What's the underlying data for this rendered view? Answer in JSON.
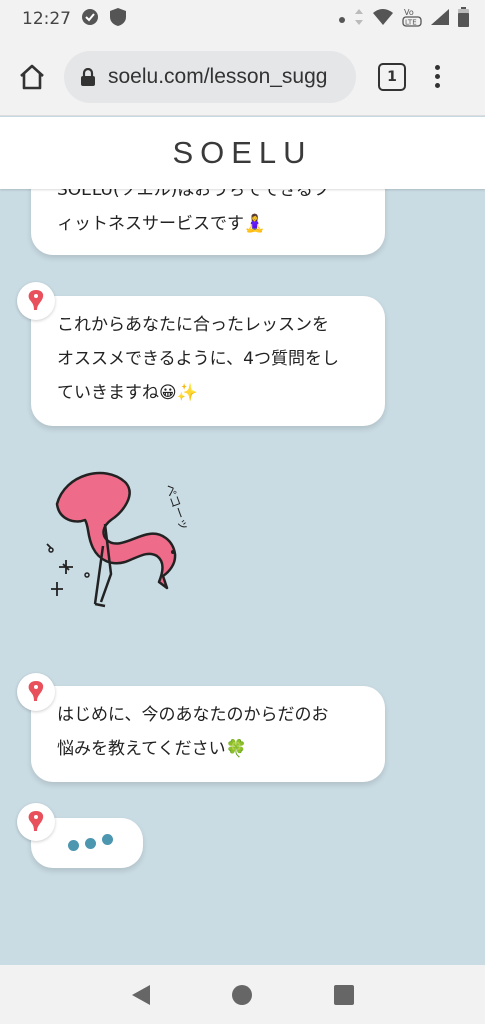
{
  "status": {
    "time": "12:27",
    "left_icons": [
      "sync-icon",
      "shield-icon"
    ],
    "right_icons": [
      "dot-icon",
      "data-arrows-icon",
      "wifi-icon",
      "volte-icon",
      "signal-icon",
      "battery-icon"
    ],
    "volte_label": "VoLTE"
  },
  "browser": {
    "url": "soelu.com/lesson_sugg",
    "tab_count": "1"
  },
  "site": {
    "logo": "SOELU"
  },
  "chat": {
    "messages": [
      {
        "line1": "SOELU(ソエル)はおうちでできるフ",
        "line2": "ィットネスサービスです",
        "emoji": "🧘‍♀️"
      },
      {
        "line1": "これからあなたに合ったレッスンを",
        "line2": "オススメできるように、4つ質問をし",
        "line3": "ていきますね",
        "emoji": "😀✨"
      },
      {
        "line1": "はじめに、今のあなたのからだのお",
        "line2": "悩みを教えてください",
        "emoji": "🍀"
      }
    ],
    "sticker_text": "ペコーッ",
    "colors": {
      "dot": "#4d96b0",
      "avatar": "#e8505b",
      "flamingo": "#ee6b8a",
      "background": "#c9dbe3"
    }
  },
  "nav": {
    "icons": [
      "back-icon",
      "home-icon",
      "recents-icon"
    ]
  }
}
